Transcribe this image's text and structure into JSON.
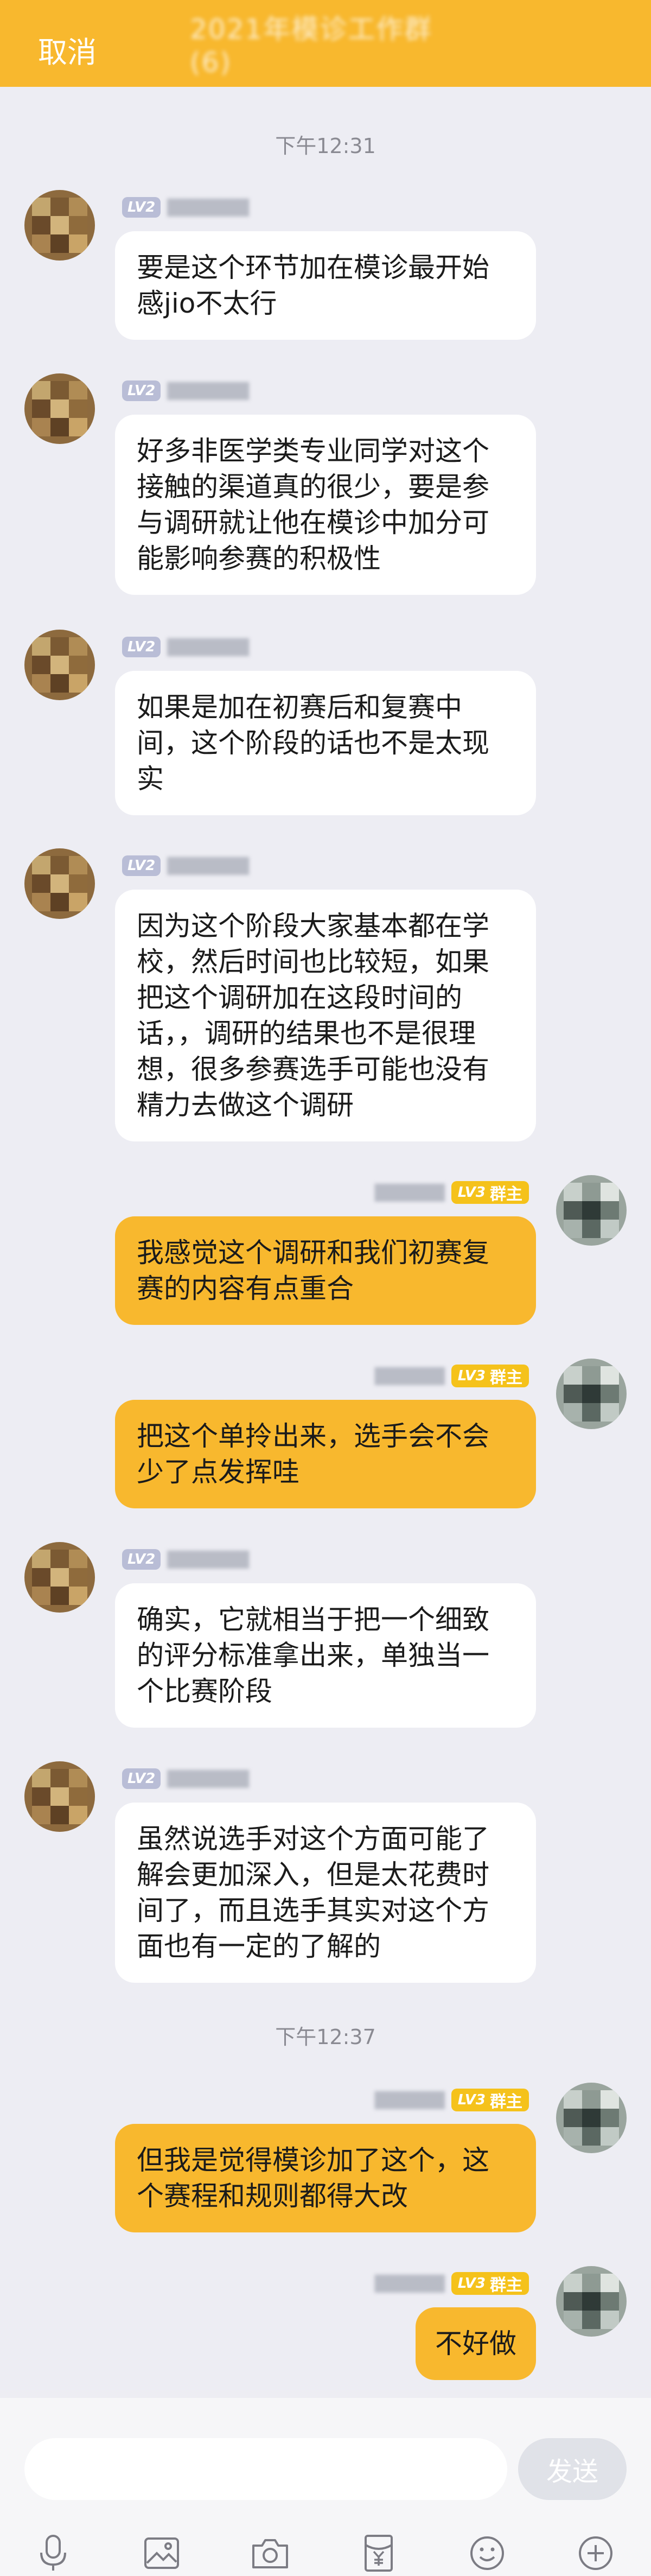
{
  "header": {
    "cancel_label": "取消",
    "title": "2021年模诊工作群(6)"
  },
  "timestamps": [
    "下午12:31",
    "下午12:37"
  ],
  "badges": {
    "lv2": "LV2",
    "lv3_level": "LV3",
    "lv3_role": "群主"
  },
  "messages": [
    {
      "side": "left",
      "text": "要是这个环节加在模诊最开始感jio不太行"
    },
    {
      "side": "left",
      "text": "好多非医学类专业同学对这个接触的渠道真的很少，要是参与调研就让他在模诊中加分可能影响参赛的积极性"
    },
    {
      "side": "left",
      "text": "如果是加在初赛后和复赛中间，这个阶段的话也不是太现实"
    },
    {
      "side": "left",
      "text": "因为这个阶段大家基本都在学校，然后时间也比较短，如果把这个调研加在这段时间的话，，调研的结果也不是很理想，很多参赛选手可能也没有精力去做这个调研"
    },
    {
      "side": "right",
      "text": "我感觉这个调研和我们初赛复赛的内容有点重合"
    },
    {
      "side": "right",
      "text": "把这个单拎出来，选手会不会少了点发挥哇"
    },
    {
      "side": "left",
      "text": "确实，它就相当于把一个细致的评分标准拿出来，单独当一个比赛阶段"
    },
    {
      "side": "left",
      "text": "虽然说选手对这个方面可能了解会更加深入，但是太花费时间了，而且选手其实对这个方面也有一定的了解的"
    },
    {
      "side": "right",
      "text": "但我是觉得模诊加了这个，这个赛程和规则都得大改"
    },
    {
      "side": "right",
      "text": "不好做"
    }
  ],
  "input": {
    "placeholder": "",
    "send_label": "发送"
  },
  "toolbar": {
    "icons": [
      "microphone-icon",
      "image-icon",
      "camera-icon",
      "red-packet-icon",
      "emoji-icon",
      "plus-icon"
    ]
  },
  "colors": {
    "brand": "#f8b82e",
    "lv2_badge": "#b9bdd6",
    "lv3_badge": "#f5c21b",
    "background": "#ededf3"
  }
}
